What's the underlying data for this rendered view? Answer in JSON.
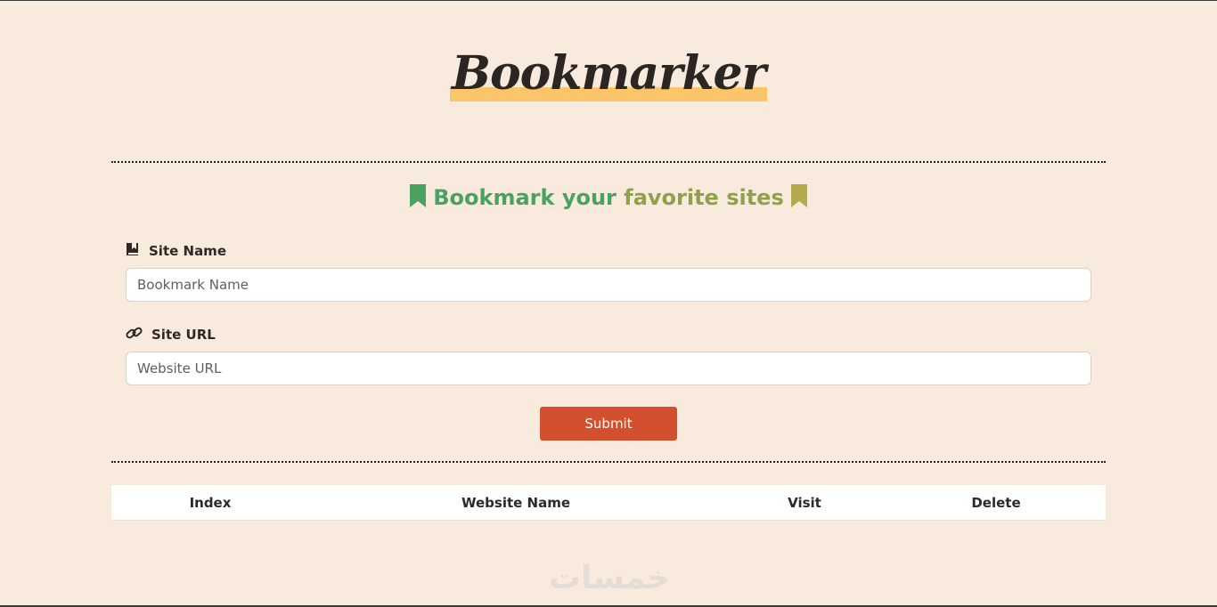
{
  "header": {
    "title": "Bookmarker"
  },
  "form": {
    "heading": "Bookmark your favorite sites",
    "heading_parts": [
      "Bookmark your",
      "favorite sites"
    ],
    "site_name_label": "Site Name",
    "site_name_placeholder": "Bookmark Name",
    "site_url_label": "Site URL",
    "site_url_placeholder": "Website URL",
    "submit_label": "Submit"
  },
  "table": {
    "columns": [
      "Index",
      "Website Name",
      "Visit",
      "Delete"
    ]
  },
  "watermark": "خمسات",
  "colors": {
    "background": "#f8ebdd",
    "accent": "#d2502e",
    "highlight": "#fdc56a",
    "heading_green": "#4aa261",
    "heading_olive": "#8fa24a"
  },
  "icons": {
    "heading_left": "bookmark-icon",
    "heading_right": "bookmark-icon",
    "site_name": "book-bookmark-icon",
    "site_url": "link-icon"
  }
}
